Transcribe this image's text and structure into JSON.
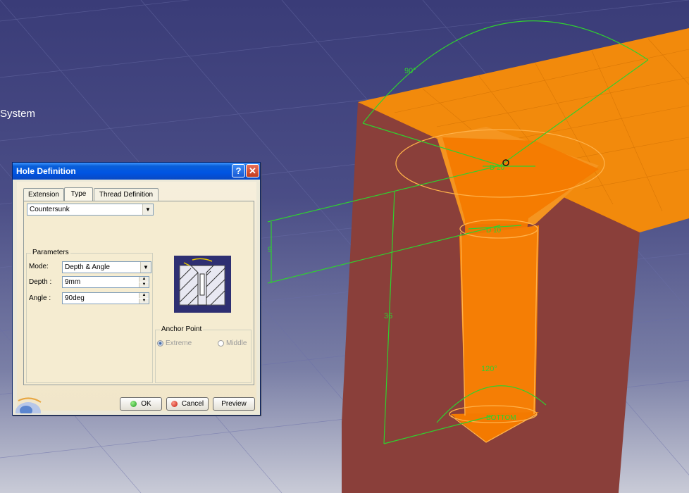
{
  "viewport": {
    "system_label": "System",
    "dimensions": {
      "top_angle": "90°",
      "countersink_diameter": "D 20",
      "hole_diameter": "D 10",
      "countersink_depth": "9",
      "hole_depth": "36",
      "bottom_angle": "120°",
      "bottom_label": "BOTTOM"
    }
  },
  "dialog": {
    "title": "Hole Definition",
    "help_icon": "?",
    "close_icon": "✕",
    "tabs": [
      {
        "label": "Extension"
      },
      {
        "label": "Type"
      },
      {
        "label": "Thread Definition"
      }
    ],
    "active_tab": "Type",
    "type_value": "Countersunk",
    "parameters": {
      "group_label": "Parameters",
      "mode_label": "Mode:",
      "mode_value": "Depth & Angle",
      "depth_label": "Depth :",
      "depth_value": "9mm",
      "angle_label": "Angle :",
      "angle_value": "90deg"
    },
    "anchor": {
      "group_label": "Anchor Point",
      "extreme_label": "Extreme",
      "middle_label": "Middle",
      "selected": "Extreme"
    },
    "buttons": {
      "ok": "OK",
      "cancel": "Cancel",
      "preview": "Preview"
    }
  },
  "colors": {
    "background_top": "#3a3c78",
    "part_orange": "#f28a0c",
    "part_dark": "#8a3f3a",
    "dimension_green": "#2fd12f",
    "titlebar_blue": "#0054e3"
  }
}
